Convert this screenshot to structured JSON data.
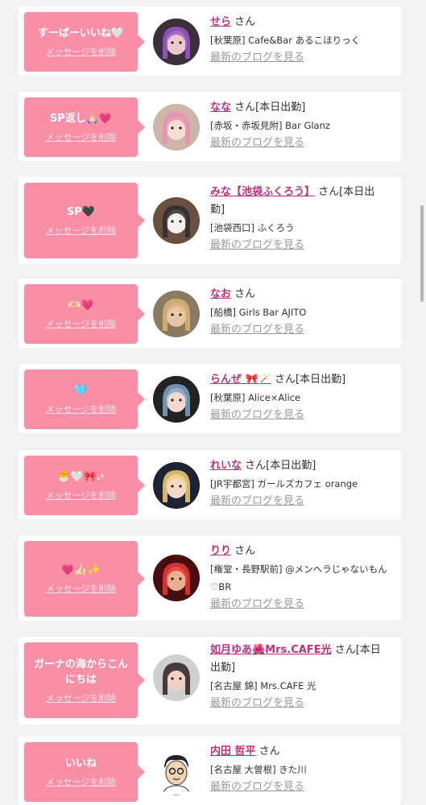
{
  "delete_label": "メッセージを削除",
  "blog_label": "最新のブログを見る",
  "colors": {
    "accent": "#f98fa6",
    "name": "#c0307a",
    "bg": "#f2f2f2"
  },
  "entries": [
    {
      "message": "すーぱーいいね🤍",
      "name": "せら",
      "suffix": " さん",
      "shop": "[秋葉原] Cafe&Bar あるこほりっく",
      "avatar": "avatar-girl-dark-hair"
    },
    {
      "message": "SP返し🙏🏻💗",
      "name": "なな",
      "suffix": " さん[本日出勤]",
      "shop": "[赤坂・赤坂見附] Bar Glanz",
      "avatar": "avatar-girl-bunny-ears"
    },
    {
      "message": "SP🖤",
      "name": "みな【池袋ふくろう】",
      "suffix": " さん[本日出勤]",
      "shop": "[池袋西口] ふくろう",
      "avatar": "avatar-white-dog"
    },
    {
      "message": "🫶🏻💗",
      "name": "なお",
      "suffix": " さん",
      "shop": "[船橋] Girls Bar AJITO",
      "avatar": "avatar-girl-blonde"
    },
    {
      "message": "🩵",
      "name": "らんぜ 🎀🪄",
      "suffix": " さん[本日出勤]",
      "shop": "[秋葉原] Alice×Alice",
      "avatar": "avatar-girl-ribbon"
    },
    {
      "message": "🐣🤍🎀.·",
      "name": "れいな",
      "suffix": " さん[本日出勤]",
      "shop": "[JR宇都宮] ガールズカフェ orange",
      "avatar": "avatar-girl-blonde-headphones"
    },
    {
      "message": "💗👍🏻✨",
      "name": "りり",
      "suffix": " さん",
      "shop": "[権堂・長野駅前] @メンヘラじゃないもん♡BR",
      "avatar": "avatar-girl-red-crown"
    },
    {
      "message": "ガーナの海からこんにちは",
      "name": "如月ゆあ🌺Mrs.CAFE光",
      "suffix": " さん[本日出勤]",
      "shop": "[名古屋 錦] Mrs.CAFE 光",
      "avatar": "avatar-girl-selfie"
    },
    {
      "message": "いいね",
      "name": "内田 哲平",
      "suffix": " さん",
      "shop": "[名古屋 大曽根] きた川",
      "avatar": "avatar-man-illustration"
    }
  ]
}
